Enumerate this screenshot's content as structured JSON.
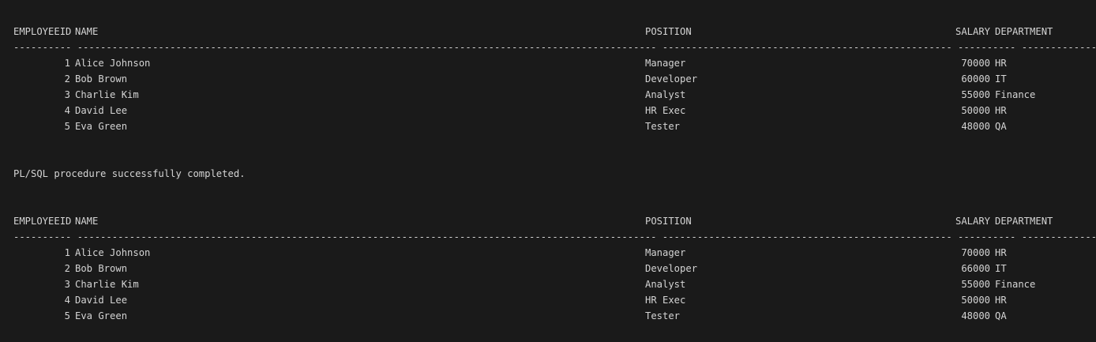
{
  "columns": {
    "id": "EMPLOYEEID",
    "name": "NAME",
    "position": "POSITION",
    "salary": "SALARY",
    "department": "DEPARTMENT"
  },
  "separator": "---------- ---------------------------------------------------------------------------------------------------- -------------------------------------------------- ---------- --------------------",
  "message": "PL/SQL procedure successfully completed.",
  "tables": [
    {
      "rows": [
        {
          "id": "1",
          "name": "Alice Johnson",
          "position": "Manager",
          "salary": "70000",
          "department": "HR"
        },
        {
          "id": "2",
          "name": "Bob Brown",
          "position": "Developer",
          "salary": "60000",
          "department": "IT"
        },
        {
          "id": "3",
          "name": "Charlie Kim",
          "position": "Analyst",
          "salary": "55000",
          "department": "Finance"
        },
        {
          "id": "4",
          "name": "David Lee",
          "position": "HR Exec",
          "salary": "50000",
          "department": "HR"
        },
        {
          "id": "5",
          "name": "Eva Green",
          "position": "Tester",
          "salary": "48000",
          "department": "QA"
        }
      ]
    },
    {
      "rows": [
        {
          "id": "1",
          "name": "Alice Johnson",
          "position": "Manager",
          "salary": "70000",
          "department": "HR"
        },
        {
          "id": "2",
          "name": "Bob Brown",
          "position": "Developer",
          "salary": "66000",
          "department": "IT"
        },
        {
          "id": "3",
          "name": "Charlie Kim",
          "position": "Analyst",
          "salary": "55000",
          "department": "Finance"
        },
        {
          "id": "4",
          "name": "David Lee",
          "position": "HR Exec",
          "salary": "50000",
          "department": "HR"
        },
        {
          "id": "5",
          "name": "Eva Green",
          "position": "Tester",
          "salary": "48000",
          "department": "QA"
        }
      ]
    }
  ]
}
